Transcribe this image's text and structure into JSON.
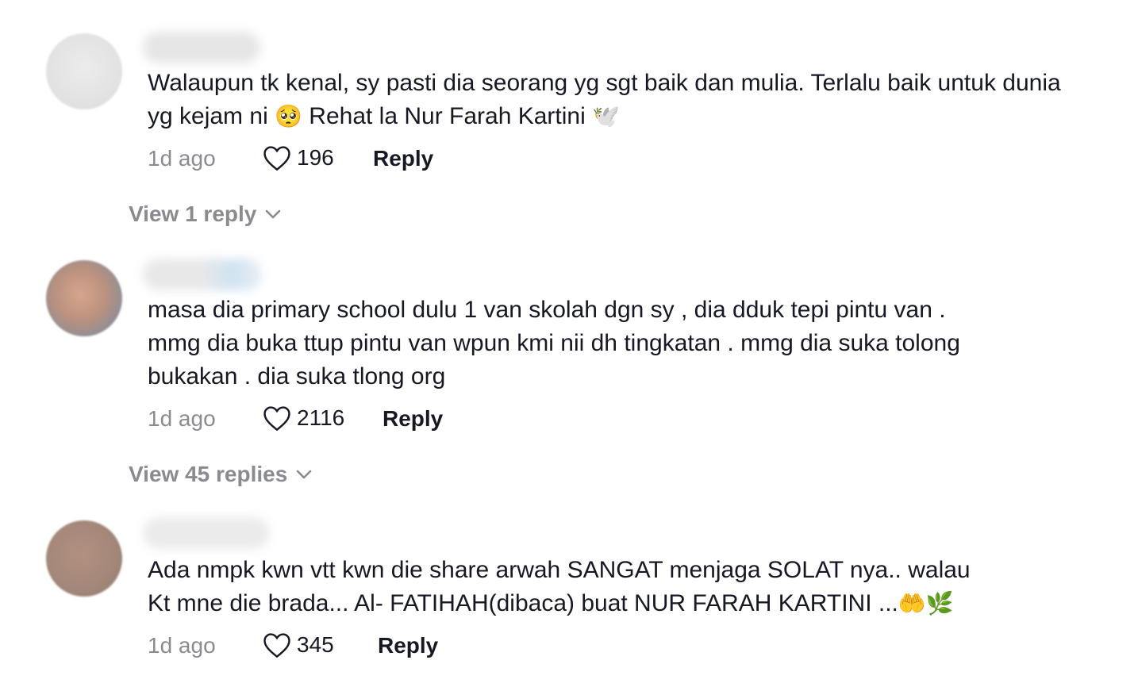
{
  "comments": [
    {
      "text_before": "Walaupun tk kenal, sy pasti dia seorang yg sgt baik dan mulia. Terlalu baik untuk dunia yg kejam ni ",
      "emoji1": "🥺",
      "text_mid": " Rehat la Nur Farah Kartini ",
      "emoji2": "🕊️",
      "time": "1d ago",
      "likes": "196",
      "reply_label": "Reply",
      "view_replies": "View 1 reply"
    },
    {
      "text_line1": "masa dia primary school dulu 1 van skolah dgn sy , dia dduk tepi pintu van .",
      "text_line2": "mmg dia buka ttup pintu van wpun kmi nii dh tingkatan . mmg dia suka tolong",
      "text_line3": "bukakan . dia suka tlong org",
      "time": "1d ago",
      "likes": "2116",
      "reply_label": "Reply",
      "view_replies": "View 45 replies"
    },
    {
      "text_line1": "Ada nmpk kwn vtt kwn die share arwah SANGAT menjaga SOLAT nya.. walau",
      "text_line2_before": "Kt mne die brada... Al- FATIHAH(dibaca) buat NUR FARAH KARTINI ...",
      "emoji1": "🤲",
      "emoji2": "🌿",
      "time": "1d ago",
      "likes": "345",
      "reply_label": "Reply"
    }
  ],
  "colors": {
    "text": "#161823",
    "muted": "#8a8b91"
  },
  "icons": [
    "heart-outline-icon",
    "chevron-down-icon"
  ]
}
